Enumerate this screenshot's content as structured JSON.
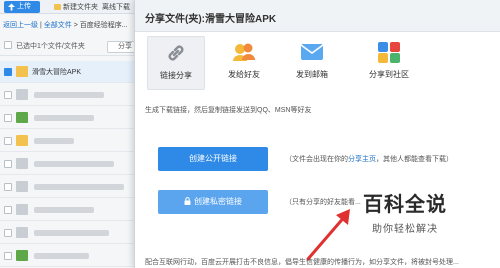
{
  "background": {
    "toolbar": {
      "upload_label": "上传",
      "new_folder_label": "新建文件夹",
      "offline_label": "离线下载"
    },
    "breadcrumb": {
      "back": "返回上一级",
      "sep": "|",
      "all_files": "全部文件",
      "arrow": ">",
      "current": "百度经验程序..."
    },
    "list_header": {
      "selected_text": "已选中1个文件/文件夹",
      "share_label": "分享"
    },
    "files": [
      {
        "name": "滑雪大冒险APK"
      }
    ]
  },
  "dialog": {
    "title": "分享文件(夹):滑雪大冒险APK",
    "tabs": [
      {
        "label": "链接分享"
      },
      {
        "label": "发给好友"
      },
      {
        "label": "发到邮箱"
      },
      {
        "label": "分享到社区"
      }
    ],
    "description": "生成下载链接，然后复制链接发送到QQ、MSN等好友",
    "public_link": {
      "button": "创建公开链接",
      "note_prefix": "（文件会出现在你的",
      "note_link": "分享主页",
      "note_suffix": "，其他人都能查看下载）"
    },
    "private_link": {
      "button": "创建私密链接",
      "note": "（只有分享的好友能看..."
    },
    "footer_note": "配合互联网行动，百度云开展打击不良信息，倡导生信健康的传播行为，如分享文件，将被封号处理..."
  },
  "watermark": {
    "title": "百科全说",
    "subtitle": "助你轻松解决"
  },
  "colors": {
    "accent_blue": "#2e8ae6",
    "light_blue": "#5ba5ee",
    "arrow_red": "#e03030"
  }
}
